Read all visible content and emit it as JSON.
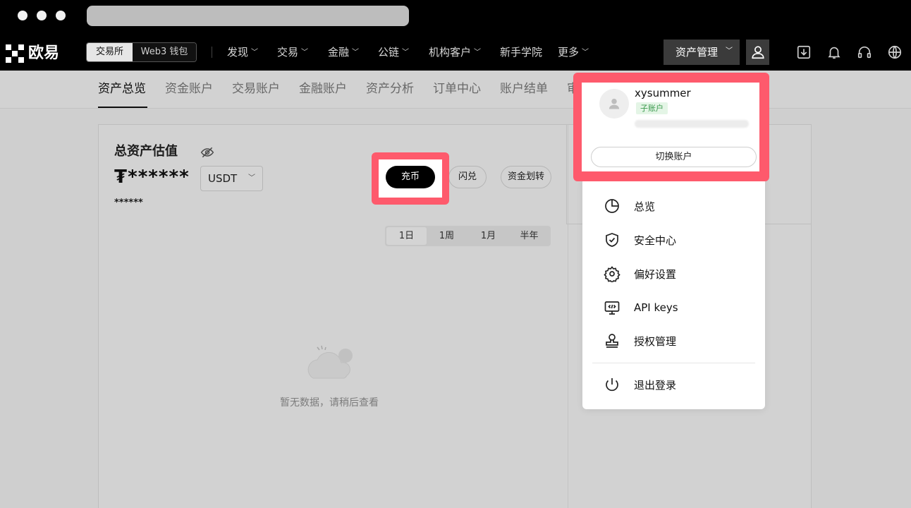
{
  "brand": {
    "name": "欧易"
  },
  "top_tabs": {
    "exchange": "交易所",
    "web3": "Web3 钱包"
  },
  "nav": {
    "items": [
      "发现",
      "交易",
      "金融",
      "公链",
      "机构客户",
      "新手学院",
      "更多"
    ],
    "asset_management": "资产管理"
  },
  "subtabs": [
    "资产总览",
    "资金账户",
    "交易账户",
    "金融账户",
    "资产分析",
    "订单中心",
    "账户结单",
    "审"
  ],
  "overview": {
    "title": "总资产估值",
    "value": "₮******",
    "currency": "USDT",
    "sub_value": "******",
    "deposit": "充币",
    "flash": "闪兑",
    "transfer": "资金划转",
    "time_ranges": [
      "1日",
      "1周",
      "1月",
      "半年"
    ],
    "empty_text": "暂无数据，请稍后查看"
  },
  "user_menu": {
    "username": "xysummer",
    "badge": "子账户",
    "switch_label": "切换账户",
    "items": [
      "总览",
      "安全中心",
      "偏好设置",
      "API keys",
      "授权管理"
    ],
    "logout": "退出登录"
  },
  "colors": {
    "highlight": "#fe5a6c",
    "badge_bg": "#e4f5e6",
    "badge_text": "#3c9a4f"
  }
}
